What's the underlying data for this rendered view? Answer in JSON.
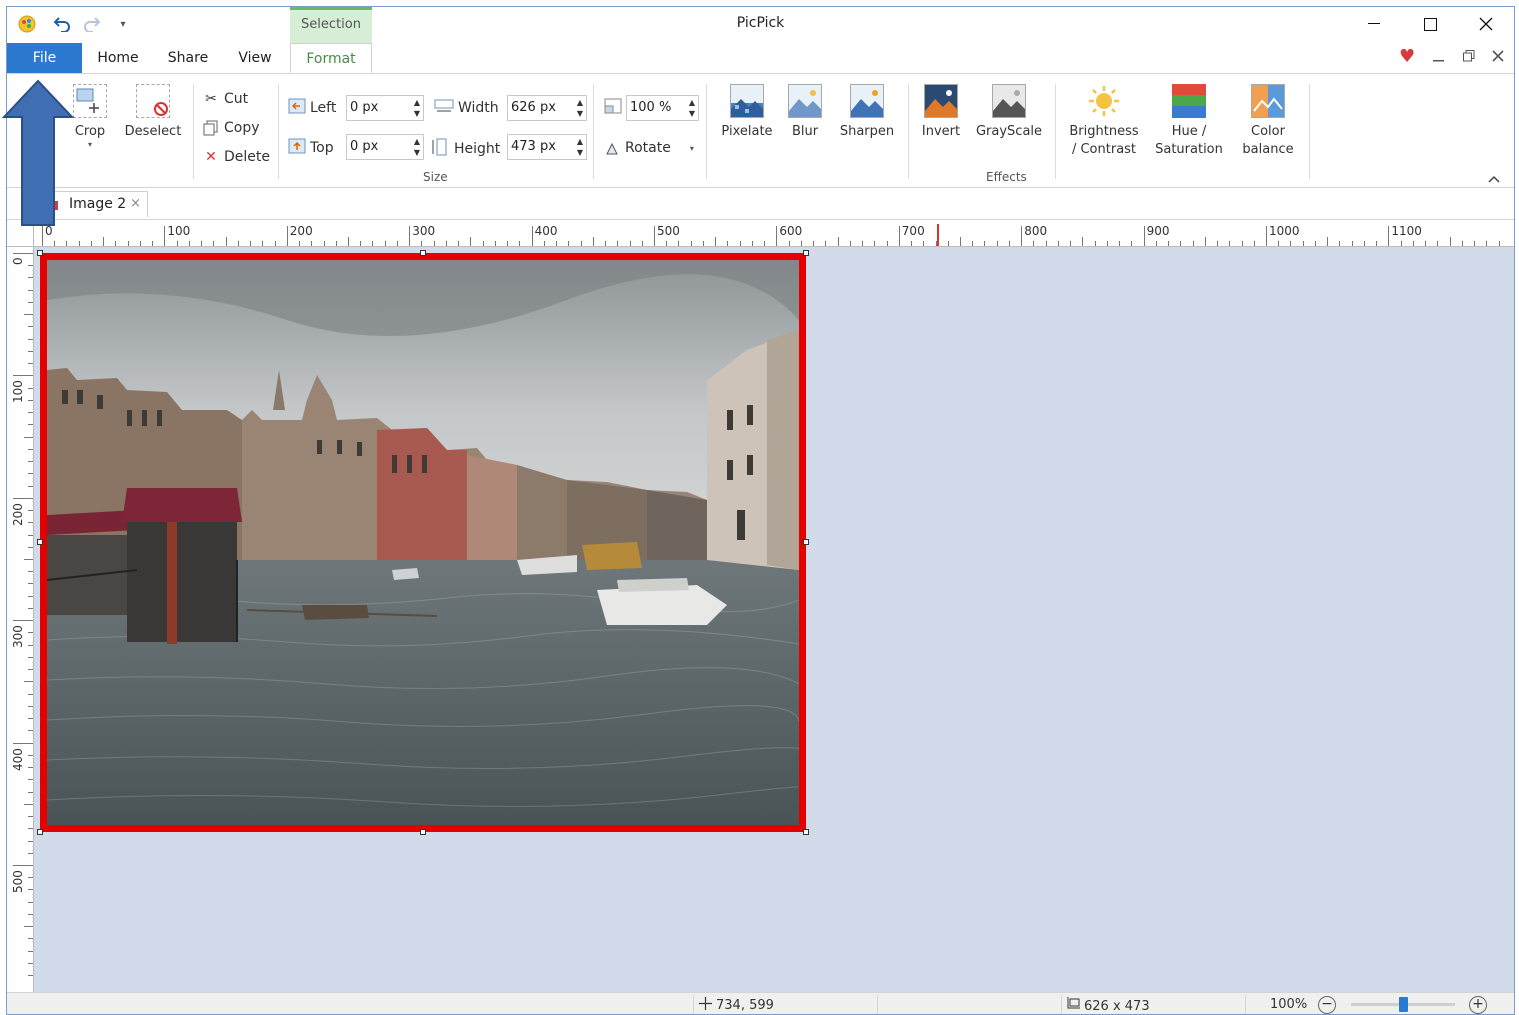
{
  "window": {
    "title": "PicPick"
  },
  "contextual_tab": {
    "label": "Selection"
  },
  "menu_tabs": [
    {
      "label": "File"
    },
    {
      "label": "Home"
    },
    {
      "label": "Share"
    },
    {
      "label": "View"
    },
    {
      "label": "Format"
    }
  ],
  "ribbon": {
    "crop_label": "Crop",
    "deselect_label": "Deselect",
    "cut_label": "Cut",
    "copy_label": "Copy",
    "delete_label": "Delete",
    "left_label": "Left",
    "left_value": "0 px",
    "top_label": "Top",
    "top_value": "0 px",
    "width_label": "Width",
    "width_value": "626 px",
    "height_label": "Height",
    "height_value": "473 px",
    "zoom_value": "100 %",
    "rotate_label": "Rotate",
    "size_group": "Size",
    "effects": [
      {
        "label": "Pixelate"
      },
      {
        "label": "Blur"
      },
      {
        "label": "Sharpen"
      },
      {
        "label": "Invert"
      },
      {
        "label": "GrayScale"
      },
      {
        "label": "Brightness\n/ Contrast"
      },
      {
        "label": "Hue /\nSaturation"
      },
      {
        "label": "Color\nbalance"
      }
    ],
    "effects_group": "Effects"
  },
  "document_tab": {
    "label": "Image 2"
  },
  "ruler": {
    "h_labels": [
      "0",
      "100",
      "200",
      "300",
      "400",
      "500",
      "600",
      "700",
      "800",
      "900",
      "1000",
      "1100"
    ],
    "v_labels": [
      "0",
      "100",
      "200",
      "300",
      "400",
      "500"
    ]
  },
  "status": {
    "cursor": "734, 599",
    "image_size": "626 x 473",
    "zoom": "100%"
  },
  "colors": {
    "accent": "#2b79d0",
    "selection_border": "#e50000",
    "canvas_bg": "#d1dbe9",
    "contextual_tab": "#d6eed6",
    "arrow": "#3f6eb3"
  }
}
